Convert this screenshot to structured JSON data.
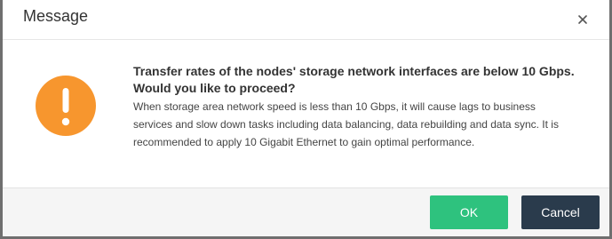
{
  "dialog": {
    "title": "Message",
    "close_icon": "close-icon"
  },
  "body": {
    "icon": "warning-exclamation-icon",
    "icon_color": "#f7962e",
    "headline": "Transfer rates of the nodes' storage network interfaces are below 10 Gbps. Would you like to proceed?",
    "description": "When storage area network speed is less than 10 Gbps, it will cause lags to business services and slow down tasks including data balancing, data rebuilding and data sync. It is recommended to apply 10 Gigabit Ethernet to gain optimal performance."
  },
  "footer": {
    "ok_label": "OK",
    "cancel_label": "Cancel",
    "ok_color": "#2ec27e",
    "cancel_color": "#2a3b4c"
  }
}
